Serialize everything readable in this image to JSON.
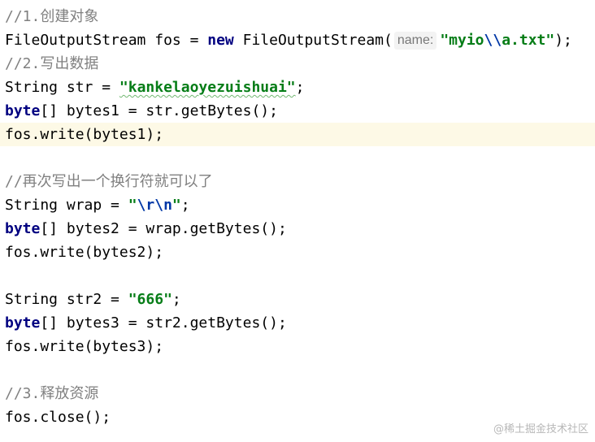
{
  "code": {
    "l1": {
      "comment": "//1.创建对象"
    },
    "l2": {
      "cls": "FileOutputStream",
      "mid": " fos = ",
      "kw": "new",
      "ctor": " FileOutputStream(",
      "hint": "name:",
      "str_open": "\"myio",
      "str_esc": "\\\\",
      "str_close": "a.txt\"",
      "end": ");"
    },
    "l3": {
      "comment": "//2.写出数据"
    },
    "l4": {
      "pre": "String str = ",
      "str": "\"kankelaoyezuishuai\"",
      "end": ";"
    },
    "l5": {
      "kw": "byte",
      "rest": "[] bytes1 = str.getBytes();"
    },
    "l6": {
      "text": "fos.write(bytes1);"
    },
    "l7": {
      "comment": "//再次写出一个换行符就可以了"
    },
    "l8": {
      "pre": "String wrap = ",
      "q1": "\"",
      "esc": "\\r\\n",
      "q2": "\"",
      "end": ";"
    },
    "l9": {
      "kw": "byte",
      "rest": "[] bytes2 = wrap.getBytes();"
    },
    "l10": {
      "text": "fos.write(bytes2);"
    },
    "l11": {
      "pre": "String str2 = ",
      "str": "\"666\"",
      "end": ";"
    },
    "l12": {
      "kw": "byte",
      "rest": "[] bytes3 = str2.getBytes();"
    },
    "l13": {
      "text": "fos.write(bytes3);"
    },
    "l14": {
      "comment": "//3.释放资源"
    },
    "l15": {
      "text": "fos.close();"
    }
  },
  "watermark": "@稀土掘金技术社区",
  "colors": {
    "comment": "#808080",
    "keyword": "#000080",
    "string": "#067d17",
    "escape": "#0037a6",
    "current_line": "#fdf9e6"
  }
}
